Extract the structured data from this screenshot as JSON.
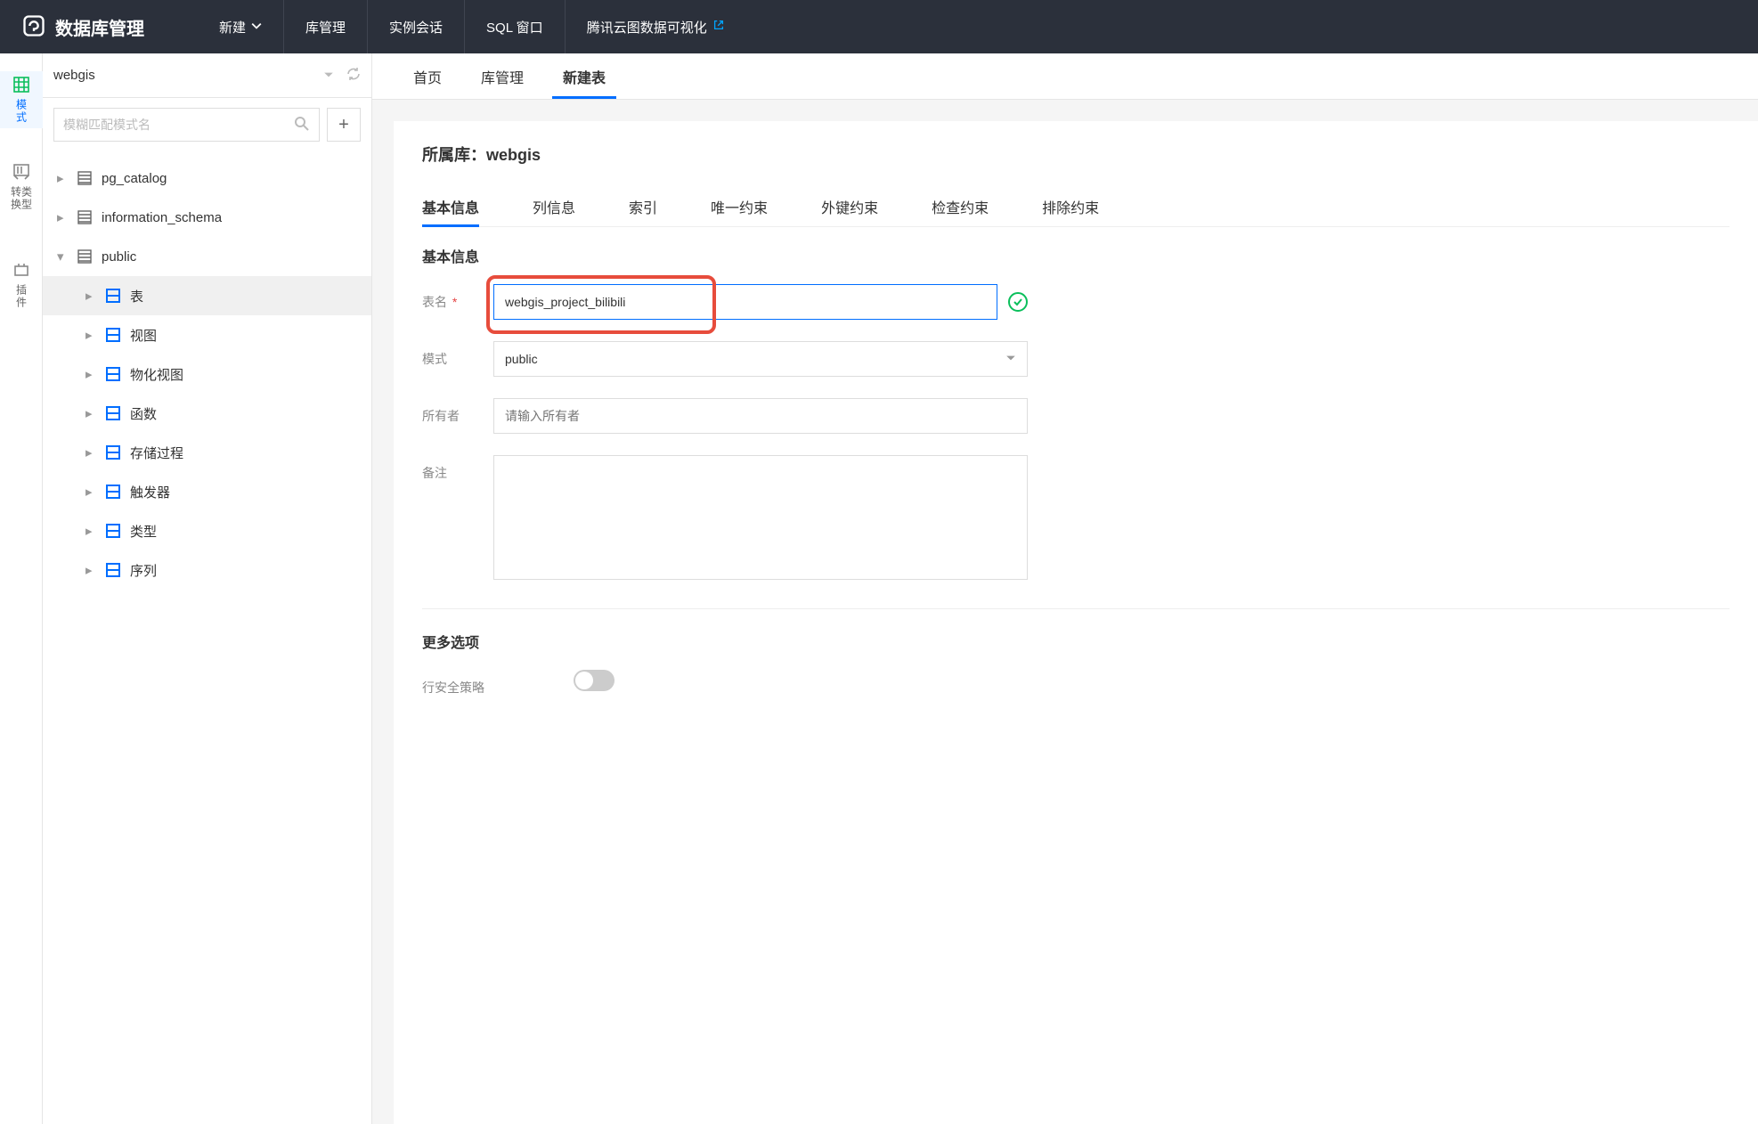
{
  "topbar": {
    "brand": "数据库管理",
    "items": {
      "new": "新建",
      "db_manage": "库管理",
      "session": "实例会话",
      "sql": "SQL 窗口",
      "tcv": "腾讯云图数据可视化"
    }
  },
  "rail": {
    "mode": "模式",
    "type_cast": "类型转换",
    "plugin": "插件"
  },
  "sidebar": {
    "db_name": "webgis",
    "search_placeholder": "模糊匹配模式名",
    "schemas": {
      "s0": "pg_catalog",
      "s1": "information_schema",
      "s2": "public"
    },
    "public_children": {
      "c0": "表",
      "c1": "视图",
      "c2": "物化视图",
      "c3": "函数",
      "c4": "存储过程",
      "c5": "触发器",
      "c6": "类型",
      "c7": "序列"
    }
  },
  "tabs": {
    "home": "首页",
    "db_manage": "库管理",
    "new_table": "新建表"
  },
  "panel": {
    "owner_db_label": "所属库：",
    "owner_db": "webgis",
    "subtabs": {
      "t0": "基本信息",
      "t1": "列信息",
      "t2": "索引",
      "t3": "唯一约束",
      "t4": "外键约束",
      "t5": "检查约束",
      "t6": "排除约束"
    },
    "section_basic": "基本信息",
    "labels": {
      "table_name": "表名",
      "schema": "模式",
      "owner": "所有者",
      "remark": "备注"
    },
    "values": {
      "table_name": "webgis_project_bilibili",
      "schema": "public"
    },
    "owner_placeholder": "请输入所有者",
    "more_options": "更多选项",
    "row_security": "行安全策略"
  }
}
